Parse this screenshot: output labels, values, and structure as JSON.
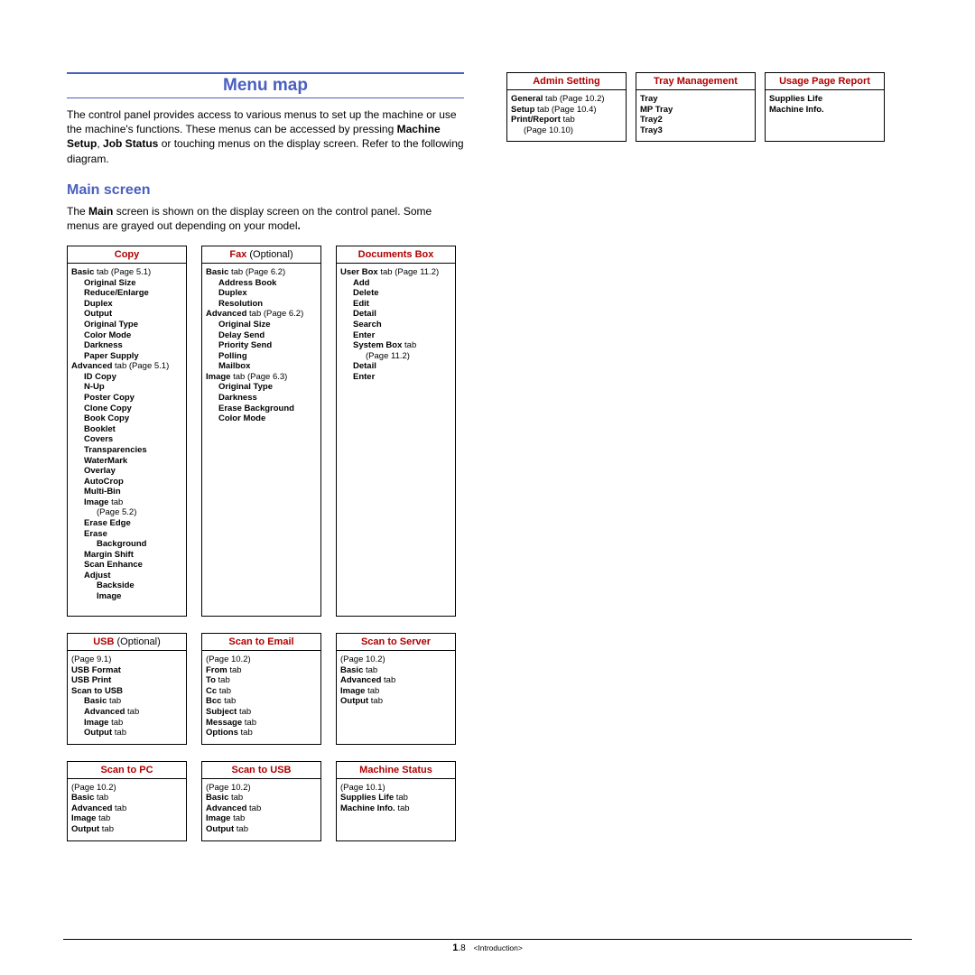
{
  "title": "Menu map",
  "intro_before": "The control panel provides access to various menus to set up the machine or use the machine's functions. These menus can be accessed by pressing ",
  "intro_bold1": "Machine Setup",
  "intro_sep": ", ",
  "intro_bold2": "Job Status",
  "intro_after": " or touching menus on the display screen. Refer to the following diagram.",
  "main_heading": "Main screen",
  "main_intro_before": "The ",
  "main_intro_bold": "Main",
  "main_intro_after": " screen is shown on the display screen on the control panel. Some menus are grayed out depending on your model",
  "main_intro_dot": ".",
  "copy": {
    "title": "Copy",
    "l1a": "Basic",
    "l1b": " tab (Page 5.1)",
    "i1": "Original Size",
    "i2": "Reduce/Enlarge",
    "i3": "Duplex",
    "i4": "Output",
    "i5": "Original Type",
    "i6": "Color Mode",
    "i7": "Darkness",
    "i8": "Paper Supply",
    "l2a": "Advanced",
    "l2b": " tab (Page 5.1)",
    "a1": "ID Copy",
    "a2": "N-Up",
    "a3": "Poster Copy",
    "a4": "Clone Copy",
    "a5": "Book Copy",
    "a6": "Booklet",
    "a7": "Covers",
    "a8": "Transparencies",
    "a9": "WaterMark",
    "a10": "Overlay",
    "a11": "AutoCrop",
    "a12": "Multi-Bin",
    "a13a": "Image",
    "a13b": " tab",
    "a13c": "(Page 5.2)",
    "e1": "Erase Edge",
    "e2a": "Erase",
    "e2b": "Background",
    "e3": "Margin Shift",
    "e4": "Scan Enhance",
    "e5a": "Adjust",
    "e5b": "Backside",
    "e5c": "Image"
  },
  "fax": {
    "title": "Fax ",
    "opt": "(Optional)",
    "l1a": "Basic",
    "l1b": " tab (Page 6.2)",
    "i1": "Address Book",
    "i2": "Duplex",
    "i3": "Resolution",
    "l2a": "Advanced",
    "l2b": " tab (Page 6.2)",
    "a1": "Original Size",
    "a2": "Delay Send",
    "a3": "Priority Send",
    "a4": "Polling",
    "a5": "Mailbox",
    "l3a": "Image",
    "l3b": " tab (Page 6.3)",
    "m1": "Original Type",
    "m2": "Darkness",
    "m3": "Erase Background",
    "m4": "Color Mode"
  },
  "doc": {
    "title": "Documents Box",
    "l1a": "User Box",
    "l1b": " tab (Page 11.2)",
    "i1": "Add",
    "i2": "Delete",
    "i3": "Edit",
    "i4": "Detail",
    "i5": "Search",
    "i6": "Enter",
    "l2a": "System Box",
    "l2b": " tab",
    "l2c": "(Page 11.2)",
    "a1": "Detail",
    "a2": "Enter"
  },
  "usb": {
    "title": "USB ",
    "opt": "(Optional)",
    "p": "(Page 9.1)",
    "i1": "USB Format",
    "i2": "USB Print",
    "i3": "Scan to USB",
    "t1a": "Basic",
    "t1b": " tab",
    "t2a": "Advanced",
    "t2b": " tab",
    "t3a": "Image",
    "t3b": " tab",
    "t4a": "Output",
    "t4b": " tab"
  },
  "s2e": {
    "title": "Scan to Email",
    "p": "(Page 10.2)",
    "t1a": "From",
    "t1b": " tab",
    "t2a": "To",
    "t2b": " tab",
    "t3a": "Cc",
    "t3b": " tab",
    "t4a": "Bcc",
    "t4b": " tab",
    "t5a": "Subject",
    "t5b": " tab",
    "t6a": "Message",
    "t6b": " tab",
    "t7a": "Options",
    "t7b": " tab"
  },
  "s2s": {
    "title": "Scan to Server",
    "p": "(Page 10.2)",
    "t1a": "Basic",
    "t1b": " tab",
    "t2a": "Advanced",
    "t2b": " tab",
    "t3a": "Image",
    "t3b": " tab",
    "t4a": "Output",
    "t4b": " tab"
  },
  "s2pc": {
    "title": "Scan to PC",
    "p": "(Page 10.2)",
    "t1a": "Basic",
    "t1b": " tab",
    "t2a": "Advanced",
    "t2b": " tab",
    "t3a": "Image",
    "t3b": " tab",
    "t4a": "Output",
    "t4b": " tab"
  },
  "s2u": {
    "title": "Scan to USB",
    "p": "(Page 10.2)",
    "t1a": "Basic",
    "t1b": " tab",
    "t2a": "Advanced",
    "t2b": " tab",
    "t3a": "Image",
    "t3b": " tab",
    "t4a": "Output",
    "t4b": " tab"
  },
  "mstatus": {
    "title": "Machine Status",
    "p": "(Page 10.1)",
    "t1a": "Supplies Life",
    "t1b": " tab",
    "t2a": "Machine Info.",
    "t2b": " tab"
  },
  "admin": {
    "title": "Admin Setting",
    "l1a": "General",
    "l1b": " tab (Page 10.2)",
    "l2a": "Setup",
    "l2b": " tab (Page 10.4)",
    "l3a": "Print/Report",
    "l3b": " tab",
    "l3c": "(Page 10.10)"
  },
  "tray": {
    "title": "Tray Management",
    "i1": "Tray",
    "i2": "MP Tray",
    "i3": "Tray2",
    "i4": "Tray3"
  },
  "usage": {
    "title": "Usage Page Report",
    "i1": "Supplies Life",
    "i2": "Machine Info."
  },
  "footer": {
    "page_pre": "1",
    "page_post": ".8",
    "chapter": "<Introduction>"
  }
}
